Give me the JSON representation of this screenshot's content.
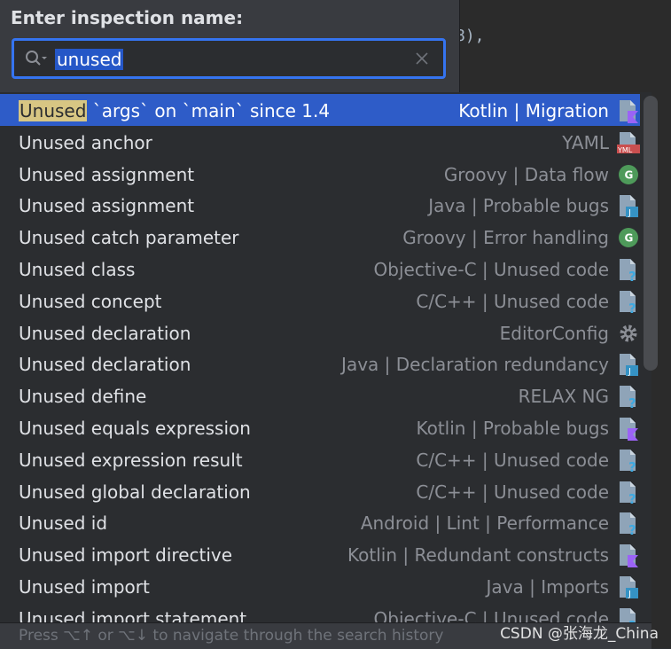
{
  "editor": {
    "code_fragment": "8),"
  },
  "popup": {
    "title": "Enter inspection name:",
    "search": {
      "value": "unused",
      "placeholder": ""
    }
  },
  "results": [
    {
      "match": "Unused",
      "rest": " `args` on `main` since 1.4",
      "category": "Kotlin | Migration",
      "icon": "kotlin-file-icon",
      "selected": true
    },
    {
      "match": "Unused",
      "rest": " anchor",
      "category": "YAML",
      "icon": "yaml-file-icon"
    },
    {
      "match": "Unused",
      "rest": " assignment",
      "category": "Groovy | Data flow",
      "icon": "groovy-icon"
    },
    {
      "match": "Unused",
      "rest": " assignment",
      "category": "Java | Probable bugs",
      "icon": "java-file-icon"
    },
    {
      "match": "Unused",
      "rest": " catch parameter",
      "category": "Groovy | Error handling",
      "icon": "groovy-icon"
    },
    {
      "match": "Unused",
      "rest": " class",
      "category": "Objective-C | Unused code",
      "icon": "unknown-file-icon"
    },
    {
      "match": "Unused",
      "rest": " concept",
      "category": "C/C++ | Unused code",
      "icon": "unknown-file-icon"
    },
    {
      "match": "Unused",
      "rest": " declaration",
      "category": "EditorConfig",
      "icon": "gear-icon"
    },
    {
      "match": "Unused",
      "rest": " declaration",
      "category": "Java | Declaration redundancy",
      "icon": "java-file-icon"
    },
    {
      "match": "Unused",
      "rest": " define",
      "category": "RELAX NG",
      "icon": "unknown-file-icon"
    },
    {
      "match": "Unused",
      "rest": " equals expression",
      "category": "Kotlin | Probable bugs",
      "icon": "kotlin-file-icon"
    },
    {
      "match": "Unused",
      "rest": " expression result",
      "category": "C/C++ | Unused code",
      "icon": "unknown-file-icon"
    },
    {
      "match": "Unused",
      "rest": " global declaration",
      "category": "C/C++ | Unused code",
      "icon": "unknown-file-icon"
    },
    {
      "match": "Unused",
      "rest": " id",
      "category": "Android | Lint | Performance",
      "icon": "unknown-file-icon"
    },
    {
      "match": "Unused",
      "rest": " import directive",
      "category": "Kotlin | Redundant constructs",
      "icon": "kotlin-file-icon"
    },
    {
      "match": "Unused",
      "rest": " import",
      "category": "Java | Imports",
      "icon": "java-file-icon"
    },
    {
      "match": "Unused",
      "rest": " import statement",
      "category": "Objective-C | Unused code",
      "icon": "unknown-file-icon"
    }
  ],
  "footer": {
    "hint": "Press ⌥↑ or ⌥↓ to navigate through the search history"
  },
  "watermark": "CSDN @张海龙_China",
  "colors": {
    "selection": "#2e5cc8",
    "match_highlight": "#d7c683",
    "accent": "#3574f0"
  }
}
